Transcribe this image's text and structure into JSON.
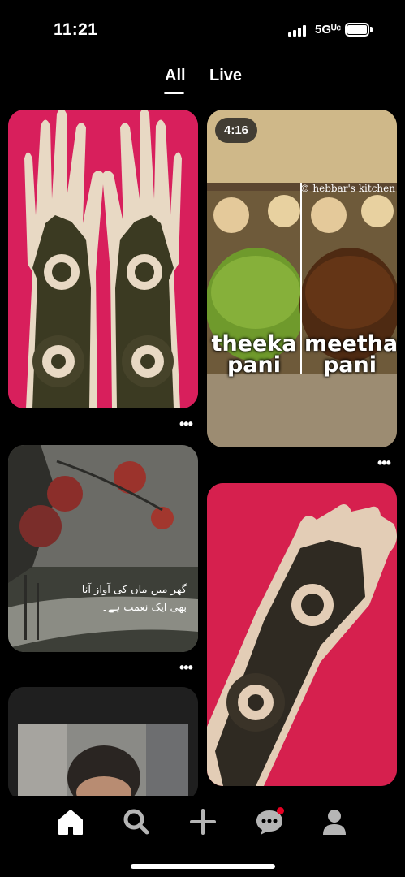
{
  "status_bar": {
    "time": "11:21",
    "network": "5Gᵁᶜ",
    "battery_level": 0.85
  },
  "tabs": [
    {
      "label": "All",
      "selected": true
    },
    {
      "label": "Live",
      "selected": false
    }
  ],
  "pins": [
    {
      "id": "henna-hands",
      "image": "mehndi-design-both-hands-on-pink"
    },
    {
      "id": "pani",
      "image": "pani-puri-water-two-bowls",
      "duration": "4:16",
      "watermark": "© hebbar's kitchen",
      "left_caption": [
        "theeka",
        "pani"
      ],
      "right_caption": [
        "meetha",
        "pani"
      ]
    },
    {
      "id": "urdu-quote",
      "image": "misty-trees-red-flowers",
      "quote_lines": [
        "گھر میں ماں کی آواز آنا",
        "بھی ایک نعمت ہے۔"
      ]
    },
    {
      "id": "henna-single-hand",
      "image": "mehndi-design-single-hand-on-pink"
    },
    {
      "id": "portrait",
      "image": "person-portrait-partial"
    }
  ],
  "more_label": "•••",
  "nav": [
    {
      "name": "home",
      "icon": "home-icon",
      "active": true
    },
    {
      "name": "search",
      "icon": "search-icon",
      "active": false
    },
    {
      "name": "create",
      "icon": "plus-icon",
      "active": false
    },
    {
      "name": "inbox",
      "icon": "chat-bubble-icon",
      "active": false,
      "has_notification": true
    },
    {
      "name": "profile",
      "icon": "profile-icon",
      "active": false
    }
  ],
  "colors": {
    "background": "#000000",
    "notification": "#e60023",
    "henna_bg": "#d81f5c",
    "nav_icon": "#b5b5b5"
  }
}
